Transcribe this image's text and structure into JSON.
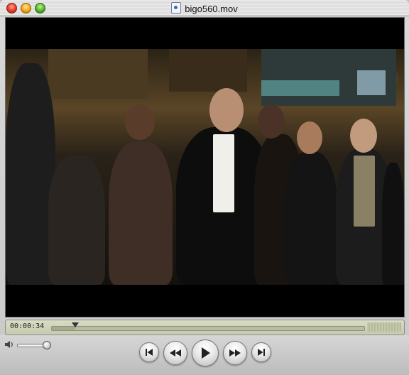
{
  "window": {
    "title": "bigo560.mov"
  },
  "player": {
    "current_time": "00:00:34",
    "progress_fraction": 0.075,
    "volume_fraction": 0.95
  },
  "controls": {
    "icons": [
      "volume-icon",
      "skip-back-icon",
      "rewind-icon",
      "play-icon",
      "fast-forward-icon",
      "skip-forward-icon"
    ]
  },
  "colors": {
    "close": "#e23b25",
    "minimize": "#f3a618",
    "zoom": "#4fb32a",
    "scrubber_bg": "#d8dcc4"
  }
}
